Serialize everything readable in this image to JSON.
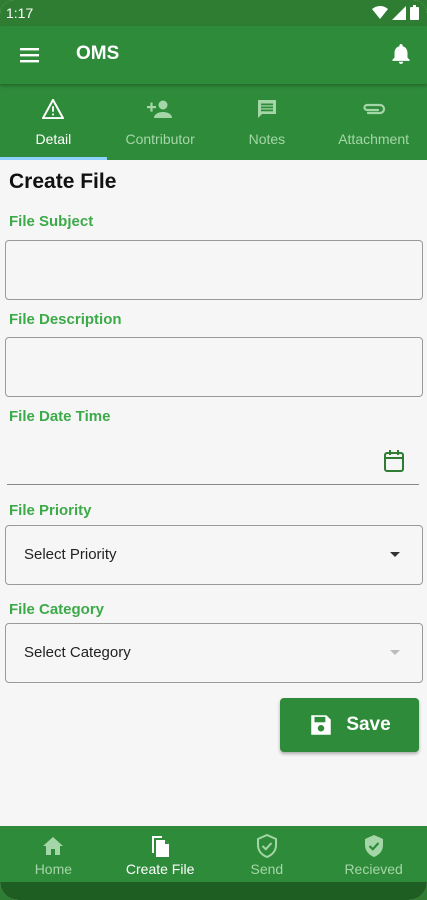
{
  "status": {
    "time": "1:17"
  },
  "appbar": {
    "title": "OMS"
  },
  "tabs": [
    {
      "label": "Detail",
      "icon": "warning-icon",
      "active": true
    },
    {
      "label": "Contributor",
      "icon": "person-add-icon"
    },
    {
      "label": "Notes",
      "icon": "comment-icon"
    },
    {
      "label": "Attachment",
      "icon": "paperclip-icon"
    }
  ],
  "form": {
    "title": "Create File",
    "subject_label": "File Subject",
    "subject_value": "",
    "description_label": "File Description",
    "description_value": "",
    "datetime_label": "File Date Time",
    "priority_label": "File Priority",
    "priority_value": "Select Priority",
    "category_label": "File Category",
    "category_value": "Select Category",
    "save_label": "Save"
  },
  "bottom_nav": [
    {
      "label": "Home",
      "icon": "home-icon"
    },
    {
      "label": "Create File",
      "icon": "file-copy-icon",
      "active": true
    },
    {
      "label": "Send",
      "icon": "shield-check-outline-icon"
    },
    {
      "label": "Recieved",
      "icon": "shield-check-icon"
    }
  ],
  "colors": {
    "primary": "#2e8b3a",
    "label_green": "#3daa49",
    "tab_indicator": "#8ed1ff"
  }
}
